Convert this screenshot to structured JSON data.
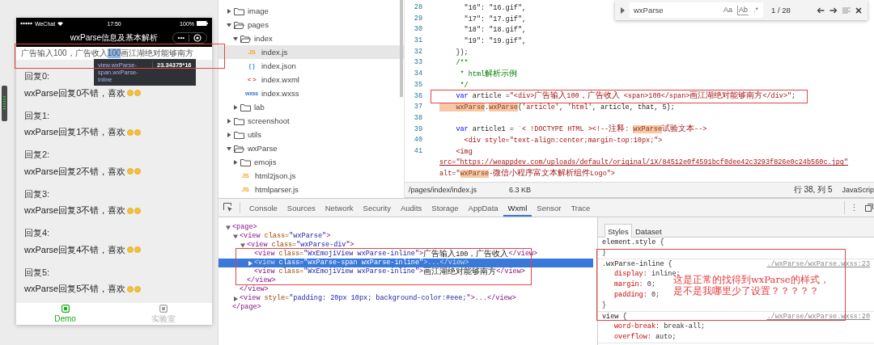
{
  "simulator": {
    "status_bar": {
      "carrier": "WeChat",
      "time": "17:50",
      "battery": "100%"
    },
    "nav_title": "wxParse信息及基本解析",
    "capsule_menu": "•••",
    "parsed_line": [
      {
        "text": "广告输入100，广告收入",
        "highlighted": false
      },
      {
        "text": "100",
        "highlighted": true
      },
      {
        "text": "画江湖绝对能够南方",
        "highlighted": false
      }
    ],
    "inspect_tooltip": {
      "selector": "view.wxParse-span.wxParse-inline",
      "size": "23.34375*16"
    },
    "replies": [
      {
        "label": "回复0:",
        "text": "wxParse回复0不错，喜欢"
      },
      {
        "label": "回复1:",
        "text": "wxParse回复1不错，喜欢"
      },
      {
        "label": "回复2:",
        "text": "wxParse回复2不错，喜欢"
      },
      {
        "label": "回复3:",
        "text": "wxParse回复3不错，喜欢"
      },
      {
        "label": "回复4:",
        "text": "wxParse回复4不错，喜欢"
      },
      {
        "label": "回复5:",
        "text": "wxParse回复5不错，喜欢"
      }
    ],
    "tabbar": [
      {
        "label": "Demo",
        "selected": true
      },
      {
        "label": "实验室",
        "selected": false
      }
    ]
  },
  "file_tree": [
    {
      "name": "image",
      "kind": "folder",
      "expanded": false,
      "selected": false
    },
    {
      "name": "pages",
      "kind": "folder",
      "expanded": true,
      "selected": false,
      "children": [
        {
          "name": "index",
          "kind": "folder",
          "expanded": true,
          "selected": false,
          "children": [
            {
              "name": "index.js",
              "kind": "js",
              "badge": "JS",
              "selected": true
            },
            {
              "name": "index.json",
              "kind": "json",
              "badge": "{ }",
              "selected": false
            },
            {
              "name": "index.wxml",
              "kind": "wxml",
              "badge": "< >",
              "selected": false
            },
            {
              "name": "index.wxss",
              "kind": "wxss",
              "badge": "wxss",
              "selected": false
            }
          ]
        },
        {
          "name": "lab",
          "kind": "folder",
          "expanded": false,
          "selected": false
        }
      ]
    },
    {
      "name": "screenshoot",
      "kind": "folder",
      "expanded": false,
      "selected": false
    },
    {
      "name": "utils",
      "kind": "folder",
      "expanded": false,
      "selected": false
    },
    {
      "name": "wxParse",
      "kind": "folder",
      "expanded": true,
      "selected": false,
      "children": [
        {
          "name": "emojis",
          "kind": "folder",
          "expanded": false,
          "selected": false
        },
        {
          "name": "html2json.js",
          "kind": "js",
          "badge": "JS",
          "selected": false
        },
        {
          "name": "htmlparser.js",
          "kind": "js",
          "badge": "JS",
          "selected": false
        }
      ]
    }
  ],
  "editor": {
    "find": {
      "value": "wxParse",
      "toggles": [
        "Aa",
        "Ab",
        ".*"
      ],
      "count": "1 / 28"
    },
    "lines": [
      {
        "number": "28",
        "tokens": [
          {
            "kind": "plain",
            "text": "      \"16\": \"16.gif\","
          }
        ]
      },
      {
        "number": "29",
        "tokens": [
          {
            "kind": "plain",
            "text": "      \"17\": \"17.gif\","
          }
        ]
      },
      {
        "number": "30",
        "tokens": [
          {
            "kind": "plain",
            "text": "      \"18\": \"18.gif\","
          }
        ]
      },
      {
        "number": "31",
        "tokens": [
          {
            "kind": "plain",
            "text": "      \"19\": \"19.gif\","
          }
        ]
      },
      {
        "number": "32",
        "tokens": [
          {
            "kind": "plain",
            "text": "    });"
          }
        ]
      },
      {
        "number": "33",
        "tokens": [
          {
            "kind": "comment",
            "text": "    /**"
          }
        ]
      },
      {
        "number": "34",
        "tokens": [
          {
            "kind": "comment",
            "text": "     * html解析示例"
          }
        ]
      },
      {
        "number": "35",
        "tokens": [
          {
            "kind": "comment",
            "text": "     */"
          }
        ]
      },
      {
        "number": "36",
        "tokens": [
          {
            "kind": "keyword",
            "text": "    var"
          },
          {
            "kind": "plain",
            "text": " article ="
          },
          {
            "kind": "string",
            "text": "\"<div>广告输入100，广告收入 <span>100</span>画江湖绝对能够南方</div>\""
          },
          {
            "kind": "plain",
            "text": ";"
          }
        ]
      },
      {
        "number": "37",
        "tokens": [
          {
            "kind": "match",
            "text": "    wxParse"
          },
          {
            "kind": "plain",
            "text": "."
          },
          {
            "kind": "match",
            "text": "wxParse"
          },
          {
            "kind": "plain",
            "text": "("
          },
          {
            "kind": "string",
            "text": "'article'"
          },
          {
            "kind": "plain",
            "text": ", "
          },
          {
            "kind": "string",
            "text": "'html'"
          },
          {
            "kind": "plain",
            "text": ", article, that, 5);"
          }
        ]
      },
      {
        "number": "38"
      },
      {
        "number": "39",
        "tokens": [
          {
            "kind": "keyword",
            "text": "    var"
          },
          {
            "kind": "plain",
            "text": " article1 = "
          },
          {
            "kind": "string",
            "text": "`< !DOCTYPE HTML ><!--注释: "
          },
          {
            "kind": "match",
            "text": "wxParse"
          },
          {
            "kind": "string",
            "text": "试验文本-->"
          }
        ]
      },
      {
        "number": "40",
        "tokens": [
          {
            "kind": "string",
            "text": "      <div style=\"text-align:center;margin-top:10px;\">"
          }
        ]
      },
      {
        "number": "41",
        "tokens": [
          {
            "kind": "string",
            "text": "    <img"
          }
        ],
        "continuation": [
          [
            {
              "kind": "url",
              "text": "src=\"https://weappdev.com/uploads/default/original/1X/84512e0f4591bcf0dee42c3293f826e0c24b560c.jpg\""
            }
          ],
          [
            {
              "kind": "string",
              "text": "alt=\""
            },
            {
              "kind": "match",
              "text": "wxParse"
            },
            {
              "kind": "string",
              "text": "-微信小程序富文本解析组件Logo\">"
            }
          ]
        ]
      }
    ],
    "status": {
      "path": "/pages/index/index.js",
      "size": "6.3 KB",
      "position": "行 38, 列 5",
      "language": "JavaScrip"
    }
  },
  "devtools": {
    "tabs": [
      {
        "label": "Console",
        "selected": false
      },
      {
        "label": "Sources",
        "selected": false
      },
      {
        "label": "Network",
        "selected": false
      },
      {
        "label": "Security",
        "selected": false
      },
      {
        "label": "Audits",
        "selected": false
      },
      {
        "label": "Storage",
        "selected": false
      },
      {
        "label": "AppData",
        "selected": false
      },
      {
        "label": "Wxml",
        "selected": true
      },
      {
        "label": "Sensor",
        "selected": false
      },
      {
        "label": "Trace",
        "selected": false
      }
    ],
    "more": "⋮",
    "wxml": [
      {
        "tokens": [
          {
            "kind": "tag",
            "text": "<page>"
          }
        ],
        "expanded": true,
        "selected": false,
        "children": [
          {
            "tokens": [
              {
                "kind": "tag",
                "text": "<view"
              },
              {
                "kind": "attr",
                "text": " class="
              },
              {
                "kind": "value",
                "text": "\"wxParse\""
              },
              {
                "kind": "tag",
                "text": ">"
              }
            ],
            "expanded": true,
            "selected": false,
            "children": [
              {
                "tokens": [
                  {
                    "kind": "tag",
                    "text": "<view"
                  },
                  {
                    "kind": "attr",
                    "text": " class="
                  },
                  {
                    "kind": "value",
                    "text": "\"wxParse-div\""
                  },
                  {
                    "kind": "tag",
                    "text": ">"
                  }
                ],
                "expanded": true,
                "selected": false,
                "children": [
                  {
                    "tokens": [
                      {
                        "kind": "tag",
                        "text": "<view"
                      },
                      {
                        "kind": "attr",
                        "text": " class="
                      },
                      {
                        "kind": "value",
                        "text": "\"WxEmojiView wxParse-inline\""
                      },
                      {
                        "kind": "tag",
                        "text": ">"
                      },
                      {
                        "kind": "text",
                        "text": "广告输入100，广告收入"
                      },
                      {
                        "kind": "tag",
                        "text": "</view>"
                      }
                    ],
                    "selected": false
                  },
                  {
                    "tokens": [
                      {
                        "kind": "tag",
                        "text": "<view"
                      },
                      {
                        "kind": "attr",
                        "text": " class="
                      },
                      {
                        "kind": "value",
                        "text": "\"wxParse-span wxParse-inline\""
                      },
                      {
                        "kind": "tag",
                        "text": ">...</view>"
                      }
                    ],
                    "expanded": false,
                    "selected": true
                  },
                  {
                    "tokens": [
                      {
                        "kind": "tag",
                        "text": "<view"
                      },
                      {
                        "kind": "attr",
                        "text": " class="
                      },
                      {
                        "kind": "value",
                        "text": "\"WxEmojiView wxParse-inline\""
                      },
                      {
                        "kind": "tag",
                        "text": ">"
                      },
                      {
                        "kind": "text",
                        "text": "画江湖绝对能够南方"
                      },
                      {
                        "kind": "tag",
                        "text": "</view>"
                      }
                    ],
                    "selected": false
                  }
                ],
                "close": [
                  {
                    "kind": "tag",
                    "text": "</view>"
                  }
                ]
              }
            ],
            "close": [
              {
                "kind": "tag",
                "text": "</view>"
              }
            ]
          },
          {
            "tokens": [
              {
                "kind": "tag",
                "text": "<view"
              },
              {
                "kind": "attr",
                "text": " style="
              },
              {
                "kind": "value",
                "text": "\"padding: 20px 10px; background-color:#eee;\""
              },
              {
                "kind": "tag",
                "text": ">...</view>"
              }
            ],
            "expanded": false,
            "selected": false
          }
        ],
        "close": [
          {
            "kind": "tag",
            "text": "</page>"
          }
        ]
      }
    ],
    "styles": {
      "tabs": [
        {
          "label": "Styles",
          "selected": true
        },
        {
          "label": "Dataset",
          "selected": false
        }
      ],
      "rules": [
        {
          "selector": "element.style {",
          "close": "}"
        },
        {
          "selector": ".wxParse-inline {",
          "source": "./wxParse/wxParse.wxss:23",
          "declarations": [
            {
              "name": "display:",
              "value": "inline;"
            },
            {
              "name": "margin:",
              "value": "0;"
            },
            {
              "name": "padding:",
              "value": "0;"
            }
          ],
          "close": "}"
        },
        {
          "selector": "view {",
          "source": "./wxParse/wxParse.wxss:20",
          "declarations": [
            {
              "name": "word-break:",
              "value": "break-all;"
            },
            {
              "name": "overflow:",
              "value": "auto;"
            }
          ]
        }
      ]
    }
  },
  "annotation": {
    "note": [
      "这是正常的找得到wxParse的样式，",
      "是不是我哪里少了设置？？？？？"
    ]
  }
}
